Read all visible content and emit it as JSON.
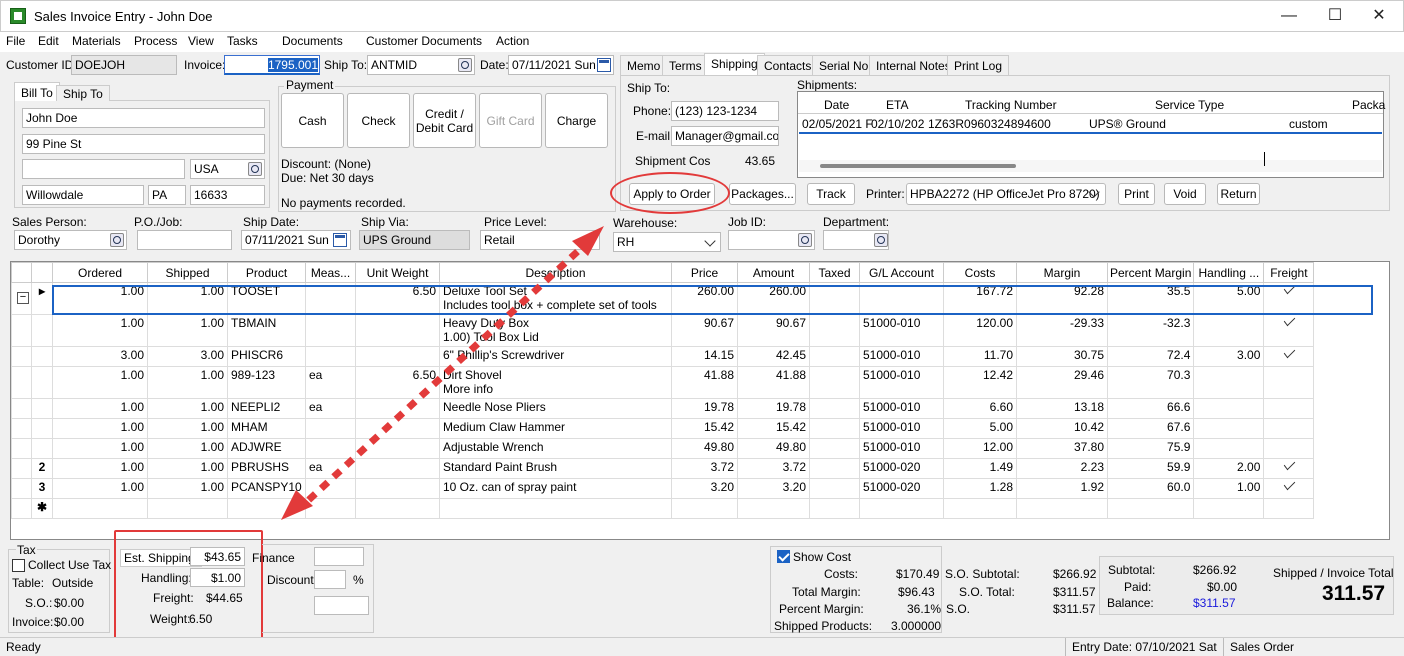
{
  "window": {
    "title": "Sales Invoice Entry - John Doe",
    "minimize": "—",
    "maximize": "☐",
    "close": "✕"
  },
  "menu": [
    "File",
    "Edit",
    "Materials",
    "Process",
    "View",
    "Tasks",
    "Documents",
    "Customer Documents",
    "Action"
  ],
  "header": {
    "customer_id_label": "Customer ID:",
    "customer_id": "DOEJOH",
    "invoice_label": "Invoice:",
    "invoice": "1795.001",
    "ship_to_label": "Ship To:",
    "ship_to": "ANTMID",
    "date_label": "Date:",
    "date": "07/11/2021 Sun"
  },
  "bill_tabs": [
    "Bill To",
    "Ship To"
  ],
  "bill_to": {
    "name": "John Doe",
    "street": "99 Pine St",
    "line2": "",
    "country": "USA",
    "city": "Willowdale",
    "state": "PA",
    "zip": "16633"
  },
  "payment": {
    "label": "Payment",
    "buttons": [
      "Cash",
      "Check",
      "Credit /\nDebit Card",
      "Gift Card",
      "Charge"
    ],
    "discount": "Discount: (None)",
    "due": "Due: Net 30  days",
    "no_payments": "No payments recorded."
  },
  "right_tabs": [
    "Memo",
    "Terms",
    "Shipping",
    "Contacts",
    "Serial No.",
    "Internal Notes",
    "Print Log"
  ],
  "shipping": {
    "ship_to_label": "Ship To:",
    "phone_label": "Phone:",
    "phone": "(123) 123-1234",
    "email_label": "E-mail:",
    "email": "Manager@gmail.com",
    "cost_label": "Shipment Cost:",
    "cost": "43.65",
    "shipments_label": "Shipments:",
    "shipments_cols": [
      "Date",
      "ETA",
      "Tracking Number",
      "Service Type",
      "Packa"
    ],
    "shipments_row": [
      "02/05/2021 F",
      "02/10/202",
      "1Z63R0960324894600",
      "UPS® Ground",
      "custom"
    ],
    "buttons": {
      "apply": "Apply to Order",
      "packages": "Packages...",
      "track": "Track",
      "printer_label": "Printer:",
      "printer": "HPBA2272 (HP OfficeJet Pro 8720)",
      "print": "Print",
      "void": "Void",
      "return": "Return"
    }
  },
  "order": {
    "sales_person_label": "Sales Person:",
    "sales_person": "Dorothy",
    "po_label": "P.O./Job:",
    "po": "",
    "ship_date_label": "Ship Date:",
    "ship_date": "07/11/2021 Sun",
    "ship_via_label": "Ship Via:",
    "ship_via": "UPS Ground",
    "price_level_label": "Price Level:",
    "price_level": "Retail",
    "warehouse_label": "Warehouse:",
    "warehouse": "RH",
    "job_id_label": "Job ID:",
    "job_id": "",
    "department_label": "Department:",
    "department": ""
  },
  "grid": {
    "columns": [
      "Ordered",
      "Shipped",
      "Product",
      "Meas...",
      "Unit Weight",
      "Description",
      "Price",
      "Amount",
      "Taxed",
      "G/L Account",
      "Costs",
      "Margin",
      "Percent Margin",
      "Handling ...",
      "Freight"
    ],
    "rows": [
      {
        "marker": "▸",
        "group": "",
        "ordered": "1.00",
        "shipped": "1.00",
        "product": "TOOSET",
        "meas": "",
        "weight": "6.50",
        "desc": "Deluxe Tool Set",
        "desc2": "Includes tool box + complete set of tools",
        "price": "260.00",
        "amount": "260.00",
        "taxed": "",
        "gl": "",
        "costs": "167.72",
        "margin": "92.28",
        "pct": "35.5",
        "handling": "5.00",
        "freight": true
      },
      {
        "marker": "",
        "group": "",
        "ordered": "1.00",
        "shipped": "1.00",
        "product": "TBMAIN",
        "meas": "",
        "weight": "",
        "desc": "Heavy Duty Box",
        "desc2": "1.00)  Tool Box Lid",
        "price": "90.67",
        "amount": "90.67",
        "taxed": "",
        "gl": "51000-010",
        "costs": "120.00",
        "margin": "-29.33",
        "pct": "-32.3",
        "handling": "",
        "freight": true
      },
      {
        "marker": "",
        "group": "",
        "ordered": "3.00",
        "shipped": "3.00",
        "product": "PHISCR6",
        "meas": "",
        "weight": "",
        "desc": "6\" Phillip's Screwdriver",
        "desc2": "",
        "price": "14.15",
        "amount": "42.45",
        "taxed": "",
        "gl": "51000-010",
        "costs": "11.70",
        "margin": "30.75",
        "pct": "72.4",
        "handling": "3.00",
        "freight": true
      },
      {
        "marker": "",
        "group": "",
        "ordered": "1.00",
        "shipped": "1.00",
        "product": "989-123",
        "meas": "ea",
        "weight": "6.50",
        "desc": "Dirt Shovel",
        "desc2": "More info",
        "price": "41.88",
        "amount": "41.88",
        "taxed": "",
        "gl": "51000-010",
        "costs": "12.42",
        "margin": "29.46",
        "pct": "70.3",
        "handling": "",
        "freight": false
      },
      {
        "marker": "",
        "group": "",
        "ordered": "1.00",
        "shipped": "1.00",
        "product": "NEEPLI2",
        "meas": "ea",
        "weight": "",
        "desc": "Needle Nose Pliers",
        "desc2": "",
        "price": "19.78",
        "amount": "19.78",
        "taxed": "",
        "gl": "51000-010",
        "costs": "6.60",
        "margin": "13.18",
        "pct": "66.6",
        "handling": "",
        "freight": false
      },
      {
        "marker": "",
        "group": "",
        "ordered": "1.00",
        "shipped": "1.00",
        "product": "MHAM",
        "meas": "",
        "weight": "",
        "desc": "Medium Claw Hammer",
        "desc2": "",
        "price": "15.42",
        "amount": "15.42",
        "taxed": "",
        "gl": "51000-010",
        "costs": "5.00",
        "margin": "10.42",
        "pct": "67.6",
        "handling": "",
        "freight": false
      },
      {
        "marker": "",
        "group": "",
        "ordered": "1.00",
        "shipped": "1.00",
        "product": "ADJWRE",
        "meas": "",
        "weight": "",
        "desc": "Adjustable Wrench",
        "desc2": "",
        "price": "49.80",
        "amount": "49.80",
        "taxed": "",
        "gl": "51000-010",
        "costs": "12.00",
        "margin": "37.80",
        "pct": "75.9",
        "handling": "",
        "freight": false
      },
      {
        "marker": "2",
        "group": "",
        "ordered": "1.00",
        "shipped": "1.00",
        "product": "PBRUSHS",
        "meas": "ea",
        "weight": "",
        "desc": "Standard Paint Brush",
        "desc2": "",
        "price": "3.72",
        "amount": "3.72",
        "taxed": "",
        "gl": "51000-020",
        "costs": "1.49",
        "margin": "2.23",
        "pct": "59.9",
        "handling": "2.00",
        "freight": true
      },
      {
        "marker": "3",
        "group": "",
        "ordered": "1.00",
        "shipped": "1.00",
        "product": "PCANSPY10",
        "meas": "",
        "weight": "",
        "desc": "10 Oz. can of spray paint",
        "desc2": "",
        "price": "3.20",
        "amount": "3.20",
        "taxed": "",
        "gl": "51000-020",
        "costs": "1.28",
        "margin": "1.92",
        "pct": "60.0",
        "handling": "1.00",
        "freight": true
      },
      {
        "marker": "✱",
        "group": "",
        "ordered": "",
        "shipped": "",
        "product": "",
        "meas": "",
        "weight": "",
        "desc": "",
        "desc2": "",
        "price": "",
        "amount": "",
        "taxed": "",
        "gl": "",
        "costs": "",
        "margin": "",
        "pct": "",
        "handling": "",
        "freight": false
      }
    ]
  },
  "tax": {
    "label": "Tax",
    "collect": "Collect Use Tax",
    "table_label": "Table:",
    "table": "Outside",
    "so_label": "S.O.:",
    "so": "$0.00",
    "invoice_label": "Invoice:",
    "invoice": "$0.00"
  },
  "shipping_summary": {
    "est_label": "Est. Shipping:",
    "est": "$43.65",
    "handling_label": "Handling:",
    "handling": "$1.00",
    "freight_label": "Freight:",
    "freight": "$44.65",
    "weight_label": "Weight:",
    "weight": "6.50"
  },
  "finance": {
    "finance_label": "Finance",
    "discount_label": "Discount:",
    "pct": "%"
  },
  "costs": {
    "show_cost": "Show Cost",
    "costs_label": "Costs:",
    "costs": "$170.49",
    "margin_label": "Total Margin:",
    "margin": "$96.43",
    "pct_label": "Percent Margin:",
    "pct": "36.1%",
    "shipped_label": "Shipped Products:",
    "shipped": "3.000000"
  },
  "so_totals": {
    "subtotal_label": "S.O. Subtotal:",
    "subtotal": "$266.92",
    "total_label": "S.O. Total:",
    "total": "$311.57",
    "so_label": "S.O.",
    "so": "$311.57"
  },
  "invoice_totals": {
    "subtotal_label": "Subtotal:",
    "subtotal": "$266.92",
    "paid_label": "Paid:",
    "paid": "$0.00",
    "balance_label": "Balance:",
    "balance": "$311.57",
    "total_label": "Shipped / Invoice Total",
    "total": "311.57"
  },
  "status": {
    "ready": "Ready",
    "entry_date": "Entry Date: 07/10/2021 Sat",
    "mode": "Sales Order"
  },
  "colors": {
    "accent_red": "#e23a3a",
    "selection_blue": "#1b62c4",
    "balance_blue": "#1a1adc"
  }
}
